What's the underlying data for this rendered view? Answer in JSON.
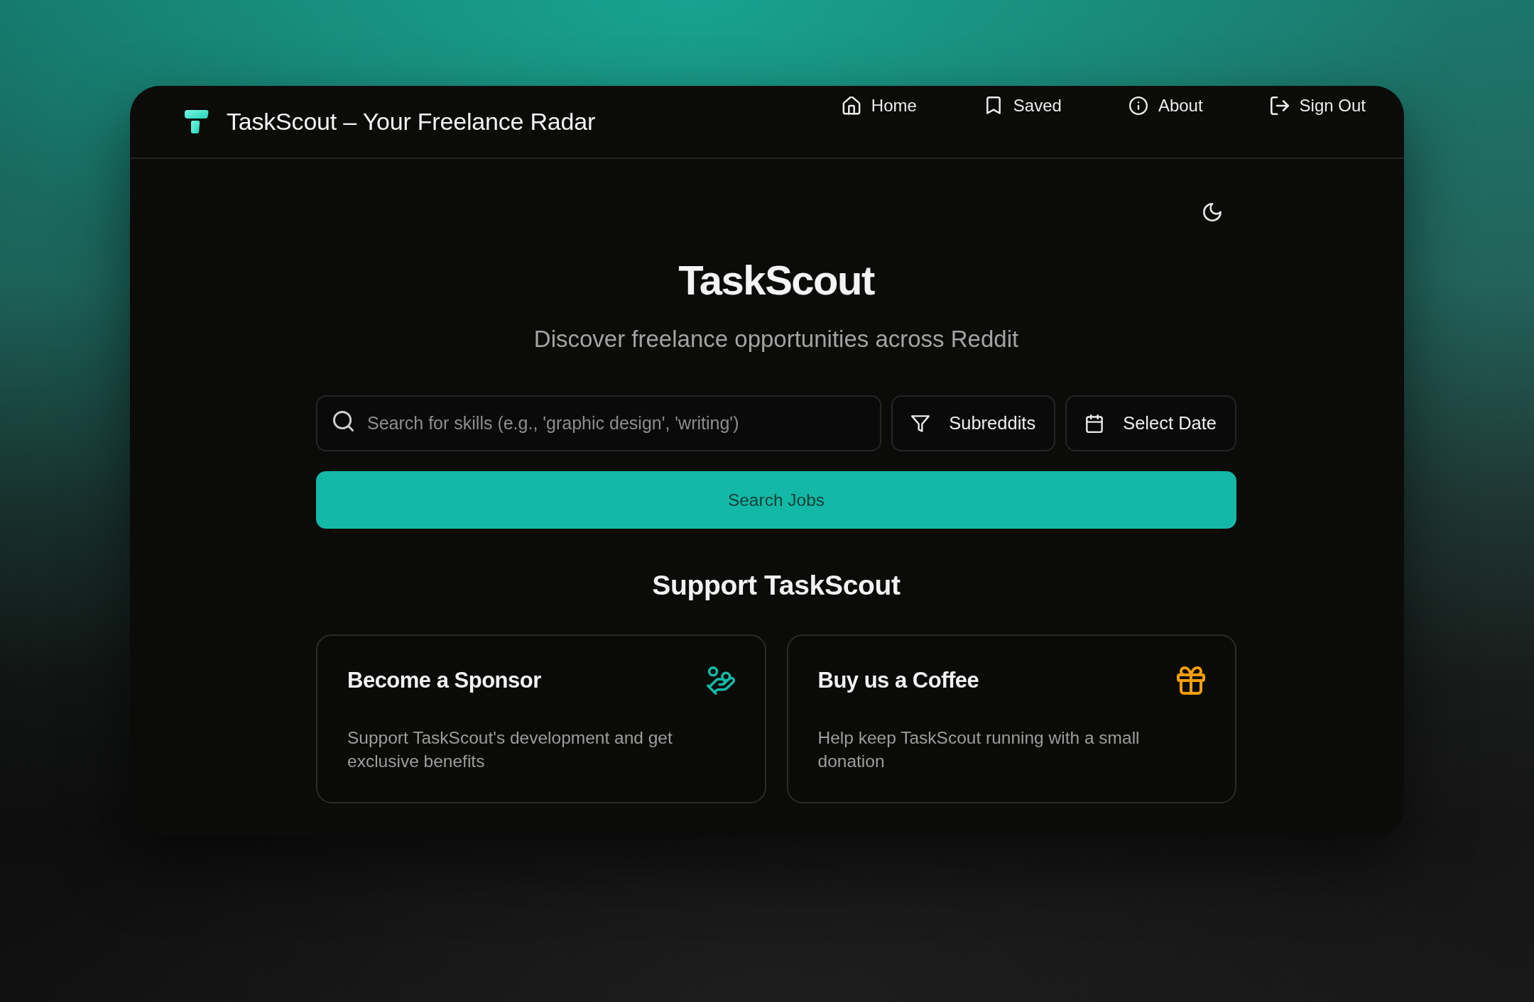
{
  "header": {
    "title": "TaskScout – Your Freelance Radar",
    "nav": [
      "Home",
      "Saved",
      "About",
      "Sign Out"
    ]
  },
  "hero": {
    "title": "TaskScout",
    "subtitle": "Discover freelance opportunities across Reddit"
  },
  "search": {
    "placeholder": "Search for skills (e.g., 'graphic design', 'writing')",
    "filters": [
      "Subreddits",
      "Select Date"
    ],
    "button": "Search Jobs"
  },
  "support": {
    "title": "Support TaskScout",
    "cards": [
      {
        "title": "Become a Sponsor",
        "description": "Support TaskScout's development and get exclusive benefits",
        "color": "#14b8a6"
      },
      {
        "title": "Buy us a Coffee",
        "description": "Help keep TaskScout running with a small donation",
        "color": "#f59e0b"
      }
    ]
  }
}
